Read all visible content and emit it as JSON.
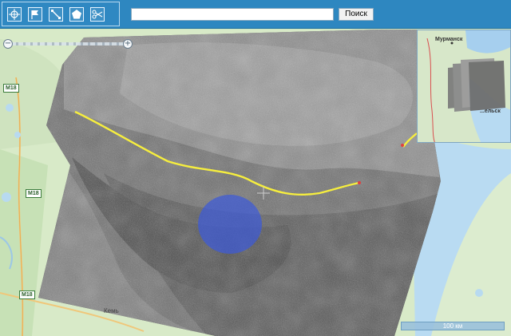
{
  "toolbar": {
    "tools": [
      {
        "name": "move-tool",
        "icon": "crosshair-move-icon"
      },
      {
        "name": "flag-tool",
        "icon": "flag-icon"
      },
      {
        "name": "line-tool",
        "icon": "diagonal-line-icon"
      },
      {
        "name": "polygon-tool",
        "icon": "pentagon-icon"
      },
      {
        "name": "scissors-tool",
        "icon": "scissors-icon"
      }
    ]
  },
  "search": {
    "value": "",
    "button_label": "Поиск"
  },
  "map": {
    "road_labels": [
      "M18",
      "M18",
      "M18"
    ],
    "town_labels": [
      "Кемь"
    ],
    "scale_label": "100 км"
  },
  "overview": {
    "city_top": "Мурманск",
    "city_bottom": "...ельск"
  },
  "colors": {
    "toolbar": "#2e87c0",
    "track": "#f4ef44",
    "aoi": "#3d5ad8"
  }
}
